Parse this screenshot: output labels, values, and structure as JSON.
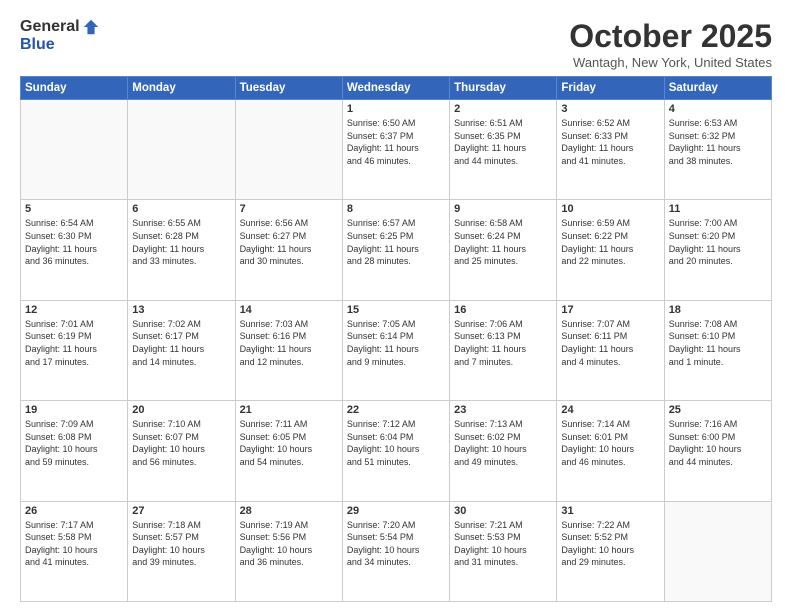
{
  "logo": {
    "general": "General",
    "blue": "Blue"
  },
  "header": {
    "month": "October 2025",
    "location": "Wantagh, New York, United States"
  },
  "weekdays": [
    "Sunday",
    "Monday",
    "Tuesday",
    "Wednesday",
    "Thursday",
    "Friday",
    "Saturday"
  ],
  "weeks": [
    [
      {
        "day": "",
        "info": ""
      },
      {
        "day": "",
        "info": ""
      },
      {
        "day": "",
        "info": ""
      },
      {
        "day": "1",
        "info": "Sunrise: 6:50 AM\nSunset: 6:37 PM\nDaylight: 11 hours\nand 46 minutes."
      },
      {
        "day": "2",
        "info": "Sunrise: 6:51 AM\nSunset: 6:35 PM\nDaylight: 11 hours\nand 44 minutes."
      },
      {
        "day": "3",
        "info": "Sunrise: 6:52 AM\nSunset: 6:33 PM\nDaylight: 11 hours\nand 41 minutes."
      },
      {
        "day": "4",
        "info": "Sunrise: 6:53 AM\nSunset: 6:32 PM\nDaylight: 11 hours\nand 38 minutes."
      }
    ],
    [
      {
        "day": "5",
        "info": "Sunrise: 6:54 AM\nSunset: 6:30 PM\nDaylight: 11 hours\nand 36 minutes."
      },
      {
        "day": "6",
        "info": "Sunrise: 6:55 AM\nSunset: 6:28 PM\nDaylight: 11 hours\nand 33 minutes."
      },
      {
        "day": "7",
        "info": "Sunrise: 6:56 AM\nSunset: 6:27 PM\nDaylight: 11 hours\nand 30 minutes."
      },
      {
        "day": "8",
        "info": "Sunrise: 6:57 AM\nSunset: 6:25 PM\nDaylight: 11 hours\nand 28 minutes."
      },
      {
        "day": "9",
        "info": "Sunrise: 6:58 AM\nSunset: 6:24 PM\nDaylight: 11 hours\nand 25 minutes."
      },
      {
        "day": "10",
        "info": "Sunrise: 6:59 AM\nSunset: 6:22 PM\nDaylight: 11 hours\nand 22 minutes."
      },
      {
        "day": "11",
        "info": "Sunrise: 7:00 AM\nSunset: 6:20 PM\nDaylight: 11 hours\nand 20 minutes."
      }
    ],
    [
      {
        "day": "12",
        "info": "Sunrise: 7:01 AM\nSunset: 6:19 PM\nDaylight: 11 hours\nand 17 minutes."
      },
      {
        "day": "13",
        "info": "Sunrise: 7:02 AM\nSunset: 6:17 PM\nDaylight: 11 hours\nand 14 minutes."
      },
      {
        "day": "14",
        "info": "Sunrise: 7:03 AM\nSunset: 6:16 PM\nDaylight: 11 hours\nand 12 minutes."
      },
      {
        "day": "15",
        "info": "Sunrise: 7:05 AM\nSunset: 6:14 PM\nDaylight: 11 hours\nand 9 minutes."
      },
      {
        "day": "16",
        "info": "Sunrise: 7:06 AM\nSunset: 6:13 PM\nDaylight: 11 hours\nand 7 minutes."
      },
      {
        "day": "17",
        "info": "Sunrise: 7:07 AM\nSunset: 6:11 PM\nDaylight: 11 hours\nand 4 minutes."
      },
      {
        "day": "18",
        "info": "Sunrise: 7:08 AM\nSunset: 6:10 PM\nDaylight: 11 hours\nand 1 minute."
      }
    ],
    [
      {
        "day": "19",
        "info": "Sunrise: 7:09 AM\nSunset: 6:08 PM\nDaylight: 10 hours\nand 59 minutes."
      },
      {
        "day": "20",
        "info": "Sunrise: 7:10 AM\nSunset: 6:07 PM\nDaylight: 10 hours\nand 56 minutes."
      },
      {
        "day": "21",
        "info": "Sunrise: 7:11 AM\nSunset: 6:05 PM\nDaylight: 10 hours\nand 54 minutes."
      },
      {
        "day": "22",
        "info": "Sunrise: 7:12 AM\nSunset: 6:04 PM\nDaylight: 10 hours\nand 51 minutes."
      },
      {
        "day": "23",
        "info": "Sunrise: 7:13 AM\nSunset: 6:02 PM\nDaylight: 10 hours\nand 49 minutes."
      },
      {
        "day": "24",
        "info": "Sunrise: 7:14 AM\nSunset: 6:01 PM\nDaylight: 10 hours\nand 46 minutes."
      },
      {
        "day": "25",
        "info": "Sunrise: 7:16 AM\nSunset: 6:00 PM\nDaylight: 10 hours\nand 44 minutes."
      }
    ],
    [
      {
        "day": "26",
        "info": "Sunrise: 7:17 AM\nSunset: 5:58 PM\nDaylight: 10 hours\nand 41 minutes."
      },
      {
        "day": "27",
        "info": "Sunrise: 7:18 AM\nSunset: 5:57 PM\nDaylight: 10 hours\nand 39 minutes."
      },
      {
        "day": "28",
        "info": "Sunrise: 7:19 AM\nSunset: 5:56 PM\nDaylight: 10 hours\nand 36 minutes."
      },
      {
        "day": "29",
        "info": "Sunrise: 7:20 AM\nSunset: 5:54 PM\nDaylight: 10 hours\nand 34 minutes."
      },
      {
        "day": "30",
        "info": "Sunrise: 7:21 AM\nSunset: 5:53 PM\nDaylight: 10 hours\nand 31 minutes."
      },
      {
        "day": "31",
        "info": "Sunrise: 7:22 AM\nSunset: 5:52 PM\nDaylight: 10 hours\nand 29 minutes."
      },
      {
        "day": "",
        "info": ""
      }
    ]
  ]
}
